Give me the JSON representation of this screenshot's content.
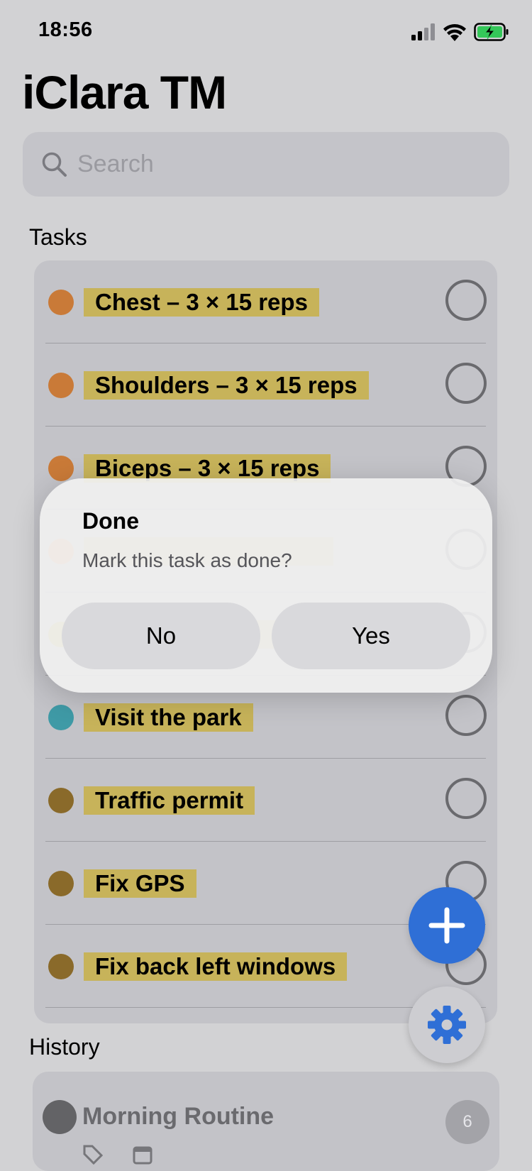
{
  "status": {
    "time": "18:56"
  },
  "app": {
    "title": "iClara TM"
  },
  "search": {
    "placeholder": "Search"
  },
  "tasks": {
    "header": "Tasks",
    "items": [
      {
        "label": "Chest – 3 × 15 reps",
        "color": "#c97a38"
      },
      {
        "label": "Shoulders – 3 × 15 reps",
        "color": "#c97a38"
      },
      {
        "label": "Biceps – 3 × 15 reps",
        "color": "#c97a38"
      },
      {
        "label": "",
        "color": "#f0a060"
      },
      {
        "label": "",
        "color": "#c9b34a"
      },
      {
        "label": "Visit the park",
        "color": "#3f9aa6"
      },
      {
        "label": "Traffic permit",
        "color": "#8a6a2a"
      },
      {
        "label": "Fix GPS",
        "color": "#8a6a2a"
      },
      {
        "label": "Fix back left windows",
        "color": "#8a6a2a"
      }
    ]
  },
  "history": {
    "header": "History",
    "items": [
      {
        "title": "Morning Routine",
        "count": "6"
      }
    ]
  },
  "dialog": {
    "title": "Done",
    "message": "Mark this task as done?",
    "no_label": "No",
    "yes_label": "Yes"
  },
  "colors": {
    "accent": "#2f6fd6",
    "highlight": "#c7b35a"
  }
}
